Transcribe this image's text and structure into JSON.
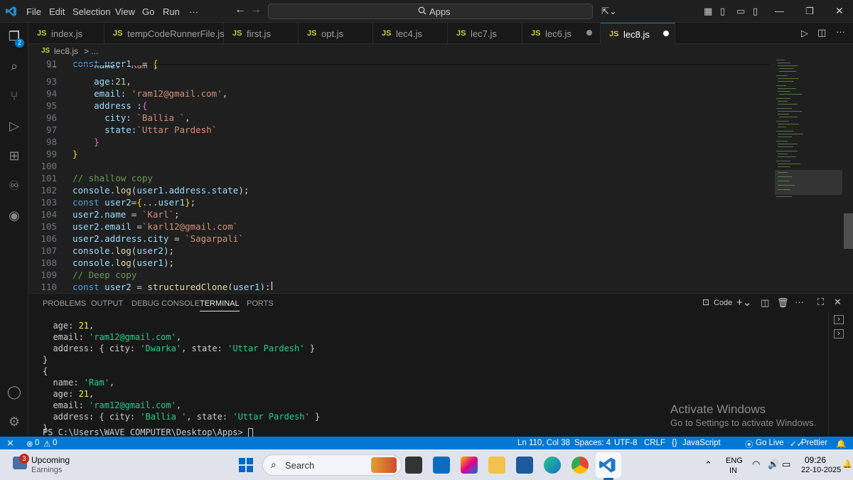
{
  "menu": [
    "File",
    "Edit",
    "Selection",
    "View",
    "Go",
    "Run",
    "···"
  ],
  "search": {
    "text": "Apps"
  },
  "tabs": [
    {
      "label": "index.js",
      "ext": "JS"
    },
    {
      "label": "tempCodeRunnerFile.js",
      "ext": "JS"
    },
    {
      "label": "first.js",
      "ext": "JS"
    },
    {
      "label": "opt.js",
      "ext": "JS"
    },
    {
      "label": "lec4.js",
      "ext": "JS"
    },
    {
      "label": "lec7.js",
      "ext": "JS"
    },
    {
      "label": "lec6.js",
      "ext": "JS"
    },
    {
      "label": "lec8.js",
      "ext": "JS"
    }
  ],
  "breadcrumb": {
    "file": "lec8.js",
    "sep": "> ...",
    "ext": "JS"
  },
  "activity": {
    "badge": "2"
  },
  "editor": {
    "line_numbers": [
      "91",
      "92",
      "93",
      "94",
      "95",
      "96",
      "97",
      "98",
      "99",
      "100",
      "101",
      "102",
      "103",
      "104",
      "105",
      "106",
      "107",
      "108",
      "109",
      "110"
    ]
  },
  "panel": {
    "tabs": [
      "PROBLEMS",
      "OUTPUT",
      "DEBUG CONSOLE",
      "TERMINAL",
      "PORTS"
    ],
    "launch": "Code",
    "prompt": "PS C:\\Users\\WAVE COMPUTER\\Desktop\\Apps> "
  },
  "watermark": {
    "line1": "Activate Windows",
    "line2": "Go to Settings to activate Windows."
  },
  "status": {
    "errors": "0",
    "warnings": "0",
    "position": "Ln 110, Col 38",
    "spaces": "Spaces: 4",
    "encoding": "UTF-8",
    "eol": "CRLF",
    "language": "JavaScript",
    "golive": "Go Live",
    "prettier": "Prettier"
  },
  "taskbar": {
    "weather_title": "Upcoming",
    "weather_sub": "Earnings",
    "weather_badge": "3",
    "search": "Search",
    "lang1": "ENG",
    "lang2": "IN",
    "time": "09:26",
    "date": "22-10-2025"
  },
  "colors": {
    "accent": "#0078d4",
    "statusbar": "#0078d4"
  }
}
